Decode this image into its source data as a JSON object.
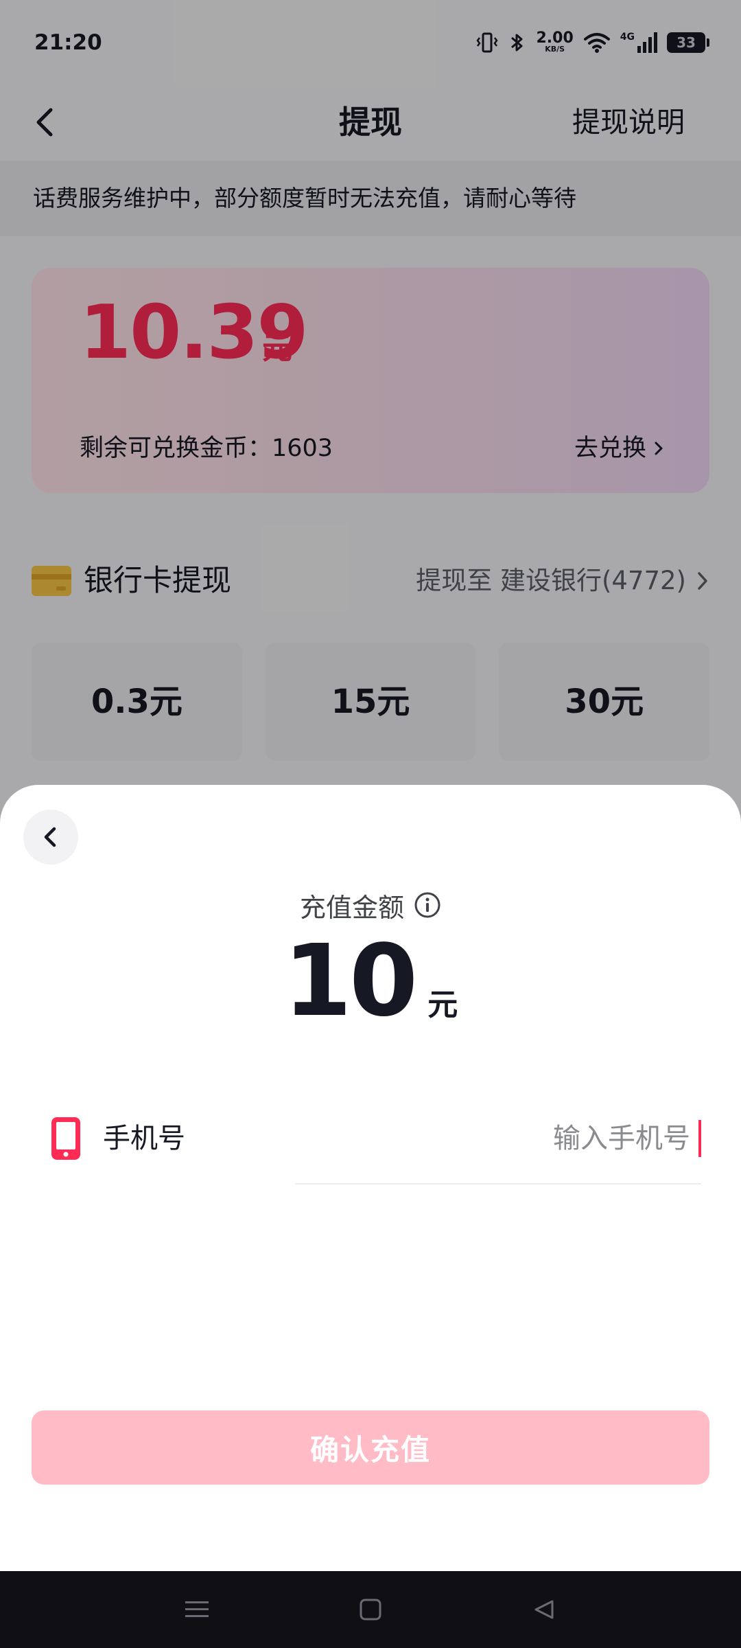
{
  "status_bar": {
    "time": "21:20",
    "net_speed_value": "2.00",
    "net_speed_unit": "KB/S",
    "network_type": "4G",
    "battery": "33"
  },
  "nav": {
    "title": "提现",
    "right_action": "提现说明"
  },
  "notice": "话费服务维护中，部分额度暂时无法充值，请耐心等待",
  "balance": {
    "amount": "10.39",
    "unit": "元",
    "coins_label": "剩余可兑换金币：1603",
    "exchange_label": "去兑换"
  },
  "bank": {
    "title": "银行卡提现",
    "target": "提现至 建设银行(4772)"
  },
  "amount_options": [
    {
      "label": "0.3元"
    },
    {
      "label": "15元"
    },
    {
      "label": "30元"
    }
  ],
  "sheet": {
    "recharge_label": "充值金额",
    "amount": "10",
    "unit": "元",
    "phone_label": "手机号",
    "phone_value": "",
    "phone_placeholder": "输入手机号",
    "confirm_label": "确认充值"
  },
  "colors": {
    "accent": "#fe2c55",
    "confirm_disabled": "#ffbcc6",
    "bank_icon": "#f6c445"
  },
  "icons": {
    "nav_back": "chevron-left-icon",
    "sheet_back": "chevron-left-icon",
    "info": "info-circle-icon",
    "phone": "mobile-phone-icon",
    "bank": "bank-card-icon",
    "system_menu": "menu-icon",
    "system_home": "home-square-icon",
    "system_back": "back-triangle-icon"
  }
}
